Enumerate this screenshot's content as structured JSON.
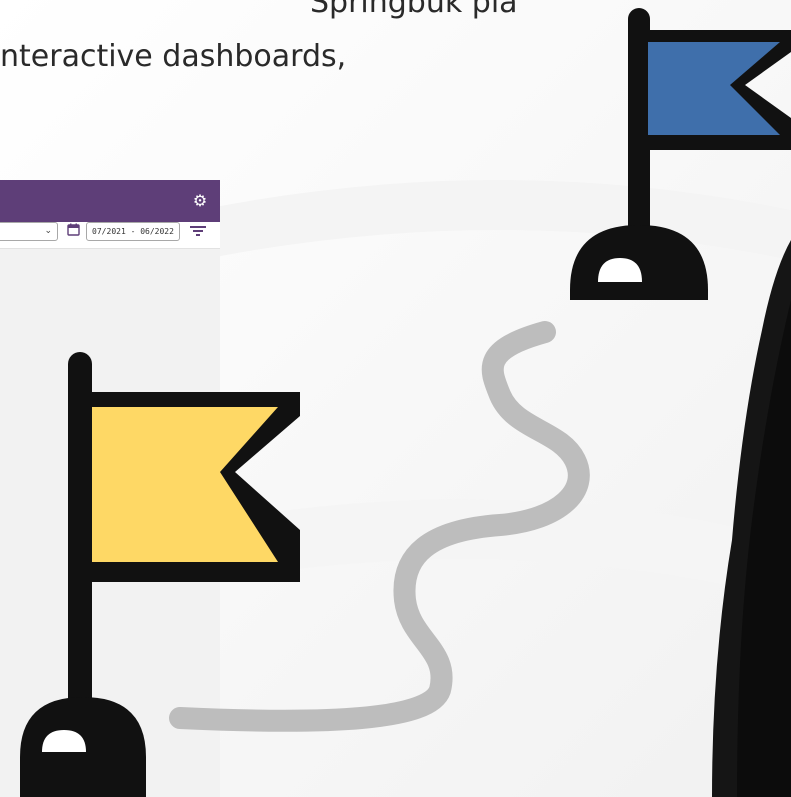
{
  "headline": {
    "line1": "Springbuk platform to",
    "line2": "nteractive dashboards,"
  },
  "app": {
    "header_color": "#5e3e78",
    "settings_icon": "gear-icon",
    "date_range": "07/2021 - 06/2022",
    "calendar_icon": "calendar-icon",
    "filter_icon": "filter-icon",
    "dropdown_icon": "chevron-down-icon"
  },
  "flags": {
    "blue_color": "#3f6fab",
    "yellow_color": "#fed865",
    "outline_color": "#111111"
  },
  "path_color": "#bdbdbd"
}
